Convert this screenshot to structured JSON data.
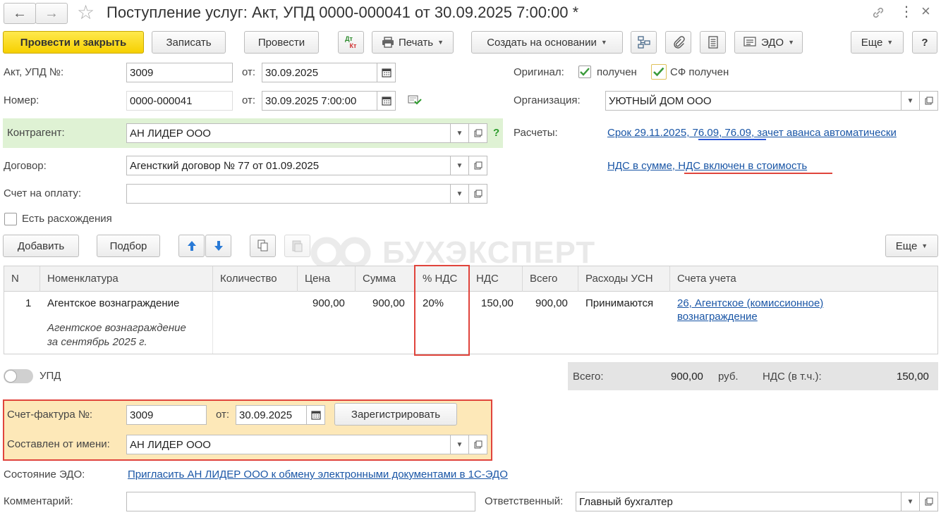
{
  "header": {
    "title": "Поступление услуг: Акт, УПД 0000-000041 от 30.09.2025 7:00:00 *"
  },
  "toolbar": {
    "post_close": "Провести и закрыть",
    "save": "Записать",
    "post": "Провести",
    "dtkt_top": "Дт",
    "dtkt_bottom": "Кт",
    "print": "Печать",
    "create_based": "Создать на основании",
    "edo": "ЭДО",
    "more": "Еще",
    "help": "?"
  },
  "form": {
    "act_label": "Акт, УПД №:",
    "act_number": "3009",
    "from_label": "от:",
    "act_date": "30.09.2025",
    "number_label": "Номер:",
    "number": "0000-000041",
    "number_datetime": "30.09.2025  7:00:00",
    "contractor_label": "Контрагент:",
    "contractor": "АН ЛИДЕР ООО",
    "contract_label": "Договор:",
    "contract": "Агенсткий договор № 77 от 01.09.2025",
    "invoice_pay_label": "Счет на оплату:",
    "invoice_pay": "",
    "discrepancy_label": "Есть расхождения",
    "original_label": "Оригинал:",
    "received_label": "получен",
    "sf_received_label": "СФ получен",
    "org_label": "Организация:",
    "org": "УЮТНЫЙ ДОМ ООО",
    "settlements_label": "Расчеты:",
    "settlements_link": "Срок 29.11.2025, 76.09, 76.09, зачет аванса автоматически",
    "vat_link": "НДС в сумме, НДС включен в стоимость",
    "help_q": "?"
  },
  "table_toolbar": {
    "add": "Добавить",
    "pick": "Подбор",
    "more": "Еще"
  },
  "watermark": "БУХЭКСПЕРТ",
  "table": {
    "columns": [
      "N",
      "Номенклатура",
      "Количество",
      "Цена",
      "Сумма",
      "% НДС",
      "НДС",
      "Всего",
      "Расходы УСН",
      "Счета учета"
    ],
    "rows": [
      {
        "n": "1",
        "item": "Агентское вознаграждение",
        "item_comment_1": "Агентское вознаграждение",
        "item_comment_2": "за сентябрь 2025 г.",
        "qty": "",
        "price": "900,00",
        "sum": "900,00",
        "vat_rate": "20%",
        "vat": "150,00",
        "total": "900,00",
        "usn": "Принимаются",
        "account_1": "26, Агентское (комиссионное)",
        "account_2": "вознаграждение"
      }
    ]
  },
  "totals": {
    "upd_label": "УПД",
    "total_label": "Всего:",
    "total_value": "900,00",
    "currency": "руб.",
    "vat_label": "НДС (в т.ч.):",
    "vat_value": "150,00"
  },
  "invoice": {
    "label": "Счет-фактура №:",
    "number": "3009",
    "from_label": "от:",
    "date": "30.09.2025",
    "register": "Зарегистрировать",
    "issuer_label": "Составлен от имени:",
    "issuer": "АН ЛИДЕР ООО"
  },
  "footer": {
    "edo_state_label": "Состояние ЭДО:",
    "edo_link": "Пригласить АН ЛИДЕР ООО к обмену электронными документами в 1С-ЭДО",
    "comment_label": "Комментарий:",
    "comment": "",
    "responsible_label": "Ответственный:",
    "responsible": "Главный бухгалтер"
  },
  "colors": {
    "primary_button": "#f6d000",
    "link": "#1a56a6",
    "highlight_red": "#e0443c",
    "contractor_bg": "#dff2d4",
    "invoice_bg": "#fde8b8",
    "totals_bg": "#e4e4e4",
    "check_green": "#3a9a3a"
  }
}
